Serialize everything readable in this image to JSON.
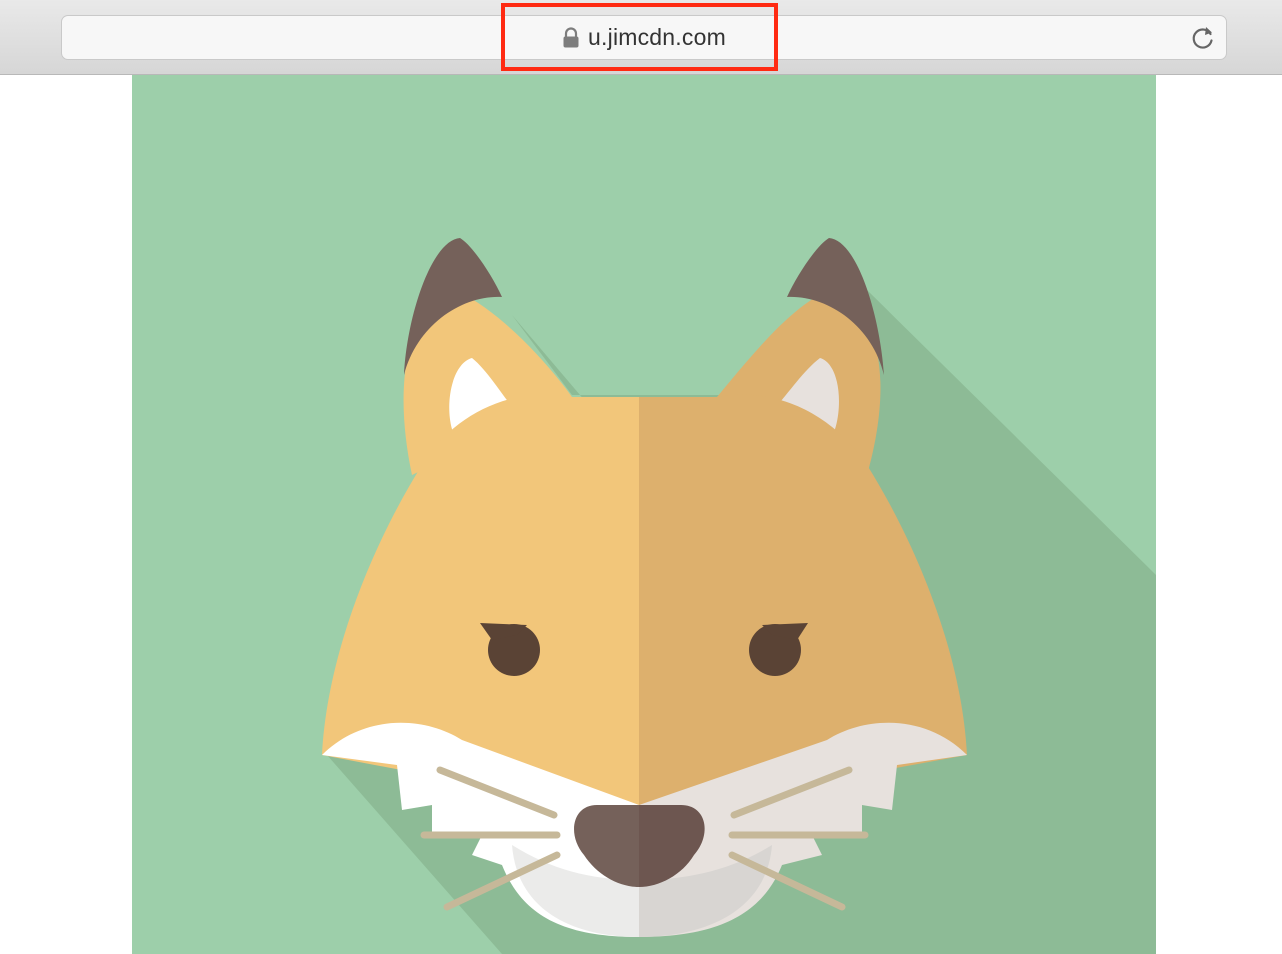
{
  "browser": {
    "url": "u.jimcdn.com",
    "lock_icon": "lock-icon",
    "reload_icon": "reload-icon",
    "highlight_color": "#ff2a12"
  },
  "content": {
    "image_subject": "fox-face-illustration",
    "colors": {
      "background": "#9dcfaa",
      "shadow": "#8dbb96",
      "fur_light": "#f2c67a",
      "fur_dark": "#ddb06d",
      "ear_tip": "#75615a",
      "eye": "#5a4335",
      "nose": "#6d5650",
      "muzzle": "#eeecea",
      "whisker": "#c6b899"
    }
  }
}
